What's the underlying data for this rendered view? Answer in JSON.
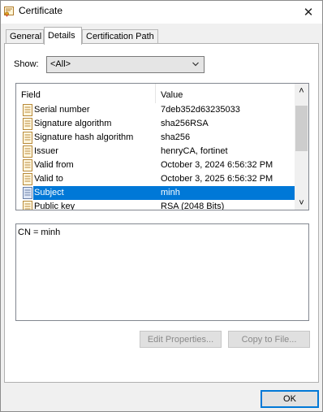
{
  "window": {
    "title": "Certificate",
    "close_glyph": "✕",
    "title_icon": "certificate-icon"
  },
  "tabs": [
    {
      "label": "General"
    },
    {
      "label": "Details",
      "active": true
    },
    {
      "label": "Certification Path"
    }
  ],
  "show": {
    "label": "Show:",
    "selected": "<All>"
  },
  "list": {
    "headers": {
      "field": "Field",
      "value": "Value"
    },
    "rows": [
      {
        "field": "Serial number",
        "value": "7deb352d63235033"
      },
      {
        "field": "Signature algorithm",
        "value": "sha256RSA"
      },
      {
        "field": "Signature hash algorithm",
        "value": "sha256"
      },
      {
        "field": "Issuer",
        "value": "henryCA, fortinet"
      },
      {
        "field": "Valid from",
        "value": "October 3, 2024 6:56:32 PM"
      },
      {
        "field": "Valid to",
        "value": "October 3, 2025 6:56:32 PM"
      },
      {
        "field": "Subject",
        "value": "minh",
        "selected": true
      },
      {
        "field": "Public key",
        "value": "RSA (2048 Bits)"
      }
    ],
    "scroll_up_glyph": "˄",
    "scroll_down_glyph": "˅"
  },
  "detail": {
    "text": "CN = minh"
  },
  "buttons": {
    "edit_properties": "Edit Properties...",
    "copy_to_file": "Copy to File...",
    "ok": "OK"
  },
  "colors": {
    "selection": "#0078d7",
    "ok_border": "#0078d7"
  }
}
